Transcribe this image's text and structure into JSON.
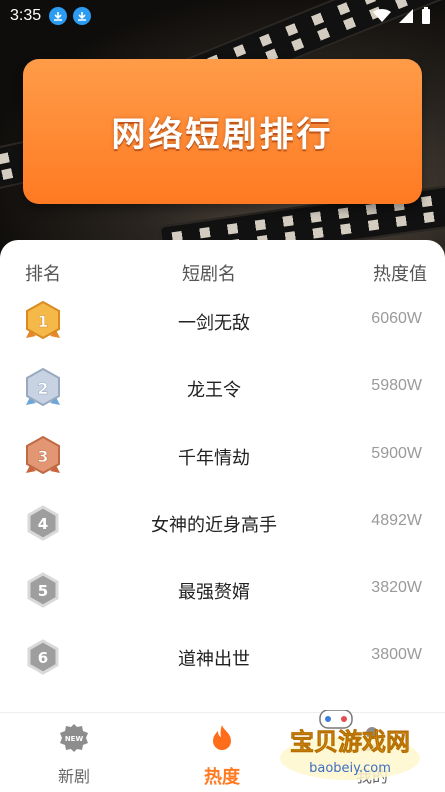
{
  "status": {
    "time": "3:35"
  },
  "banner": {
    "title": "网络短剧排行"
  },
  "table": {
    "headers": [
      "排名",
      "短剧名",
      "热度值"
    ],
    "rows": [
      {
        "rank": "1",
        "name": "一剑无敌",
        "value": "6060W",
        "medal": "gold"
      },
      {
        "rank": "2",
        "name": "龙王令",
        "value": "5980W",
        "medal": "silver"
      },
      {
        "rank": "3",
        "name": "千年情劫",
        "value": "5900W",
        "medal": "bronze"
      },
      {
        "rank": "4",
        "name": "女神的近身高手",
        "value": "4892W",
        "medal": "plain"
      },
      {
        "rank": "5",
        "name": "最强赘婿",
        "value": "3820W",
        "medal": "plain"
      },
      {
        "rank": "6",
        "name": "道神出世",
        "value": "3800W",
        "medal": "plain"
      }
    ]
  },
  "tabs": [
    {
      "label": "新剧",
      "icon": "new-badge-icon",
      "active": false
    },
    {
      "label": "热度",
      "icon": "flame-icon",
      "active": true
    },
    {
      "label": "我的",
      "icon": "profile-icon",
      "active": false
    }
  ],
  "watermark": {
    "text": "宝贝游戏网",
    "url": "baobeiy.com"
  },
  "colors": {
    "accent": "#ff7a22",
    "gold": "#f2a93b",
    "silver": "#b9c7d8",
    "bronze": "#d9825d",
    "plain": "#9e9e9e"
  }
}
